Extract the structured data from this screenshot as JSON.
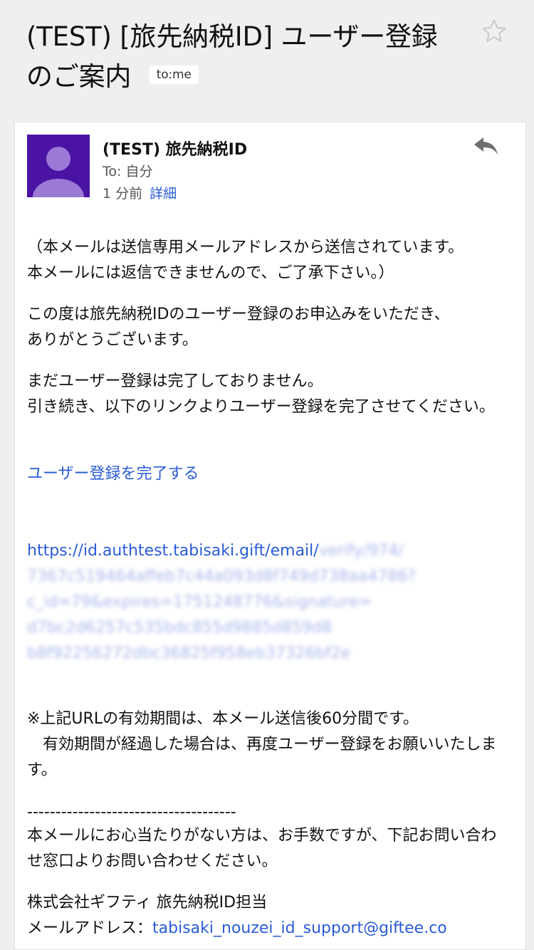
{
  "message": {
    "subject": "(TEST) [旅先納税ID] ユーザー登録のご案内",
    "recipient_chip": "to:me"
  },
  "sender": {
    "name": "(TEST) 旅先納税ID",
    "recipient_line": "To: 自分",
    "time": "1 分前",
    "details_label": "詳細"
  },
  "body": {
    "p1": "（本メールは送信専用メールアドレスから送信されています。\n本メールには返信できませんので、ご了承下さい。）",
    "p2": "この度は旅先納税IDのユーザー登録のお申込みをいただき、\nありがとうございます。",
    "p3": "まだユーザー登録は完了しておりません。\n引き続き、以下のリンクよりユーザー登録を完了させてください。",
    "complete_link": "ユーザー登録を完了する",
    "url_visible": "https://id.authtest.tabisaki.gift/email/",
    "url_blurred": "verify/974/\n7367c519464affeb7c44a093d8f749d738aa4786?\nc_id=79&expires=1751248776&signature=\nd7bc2d6257c535bdc855d9885d859d8\nb8f92256272dbc36825f958eb37326bf2e",
    "p4": "※上記URLの有効期間は、本メール送信後60分間です。\n　有効期間が経過した場合は、再度ユーザー登録をお願いいたします。",
    "divider": "-------------------------------------",
    "p5": "本メールにお心当たりがない方は、お手数ですが、下記お問い合わせ窓口よりお問い合わせください。",
    "signature": "株式会社ギフティ 旅先納税ID担当",
    "email_label": "メールアドレス：",
    "email": "tabisaki_nouzei_id_support@giftee.co"
  },
  "icons": {
    "star": "star-outline-icon",
    "reply": "reply-icon",
    "avatar": "person-avatar-icon"
  },
  "colors": {
    "avatar_bg": "#4a13a3",
    "link": "#2a5bd7",
    "background": "#efefef"
  }
}
